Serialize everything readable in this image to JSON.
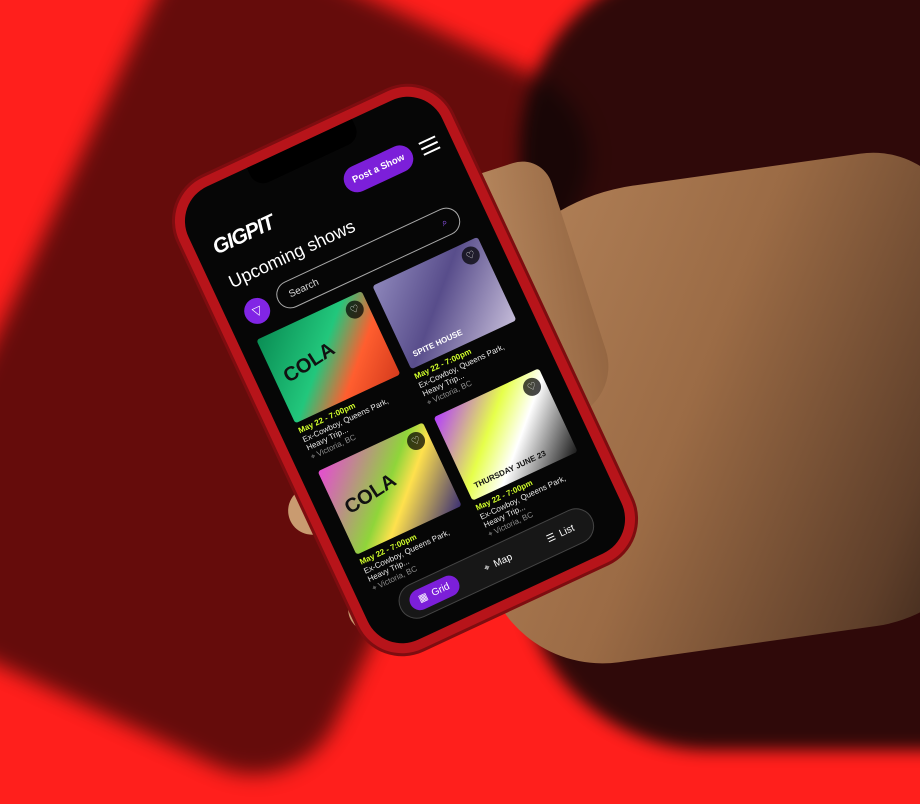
{
  "header": {
    "logo": "GIGPIT",
    "post_label": "Post a Show",
    "menu_icon": "hamburger-icon"
  },
  "main": {
    "title": "Upcoming shows",
    "search_placeholder": "Search",
    "filter_icon": "filter-icon",
    "search_icon": "search-icon",
    "cards": [
      {
        "date": "May 22 - 7:00pm",
        "venue": "Ex-Cowboy, Queens Park, Heavy Trip...",
        "location": "Victoria, BC",
        "poster_title": "COLA"
      },
      {
        "date": "May 22 - 7:00pm",
        "venue": "Ex-Cowboy, Queens Park, Heavy Trip...",
        "location": "Victoria, BC",
        "poster_title": "SPITE HOUSE"
      },
      {
        "date": "May 22 - 7:00pm",
        "venue": "Ex-Cowboy, Queens Park, Heavy Trip...",
        "location": "Victoria, BC",
        "poster_title": "COLA"
      },
      {
        "date": "May 22 - 7:00pm",
        "venue": "Ex-Cowboy, Queens Park, Heavy Trip...",
        "location": "Victoria, BC",
        "poster_title": "THURSDAY JUNE 23"
      }
    ]
  },
  "bottom_nav": {
    "tabs": [
      {
        "label": "Grid",
        "icon": "grid-icon"
      },
      {
        "label": "Map",
        "icon": "map-pin-icon"
      },
      {
        "label": "List",
        "icon": "list-icon"
      }
    ]
  },
  "colors": {
    "accent": "#7c1fd9",
    "highlight": "#d2ff2c",
    "background": "#060606"
  }
}
